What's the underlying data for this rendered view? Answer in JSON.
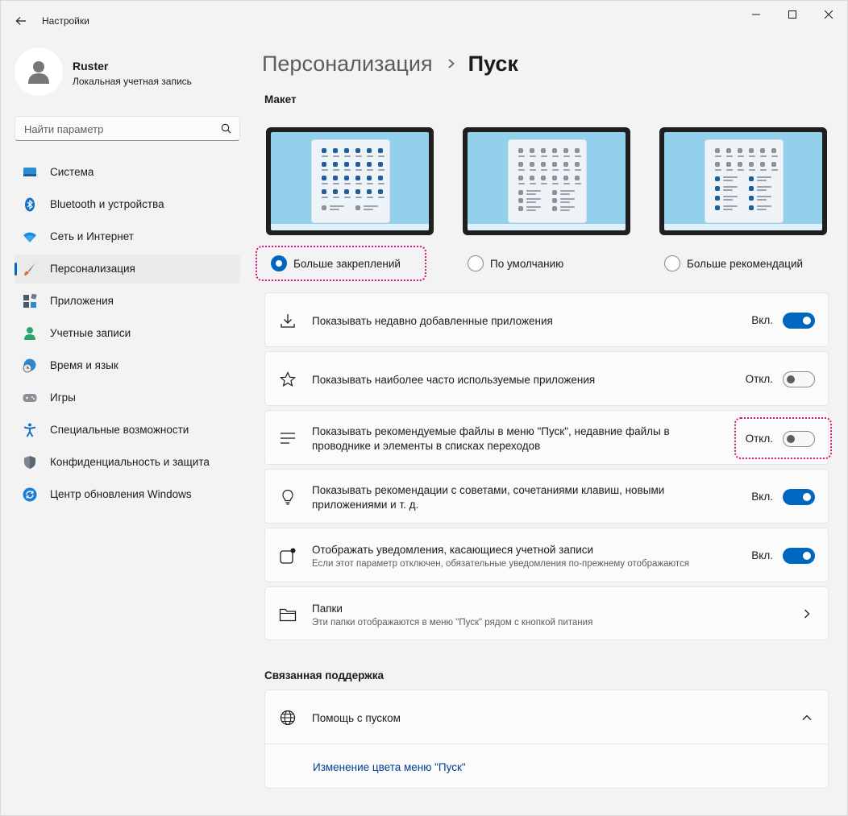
{
  "window": {
    "title": "Настройки"
  },
  "profile": {
    "name": "Ruster",
    "account_type": "Локальная учетная запись"
  },
  "search": {
    "placeholder": "Найти параметр"
  },
  "sidebar": {
    "items": [
      {
        "label": "Система",
        "icon": "system-icon"
      },
      {
        "label": "Bluetooth и устройства",
        "icon": "bluetooth-icon"
      },
      {
        "label": "Сеть и Интернет",
        "icon": "wifi-icon"
      },
      {
        "label": "Персонализация",
        "icon": "brush-icon",
        "active": true
      },
      {
        "label": "Приложения",
        "icon": "apps-icon"
      },
      {
        "label": "Учетные записи",
        "icon": "account-icon"
      },
      {
        "label": "Время и язык",
        "icon": "globe-clock-icon"
      },
      {
        "label": "Игры",
        "icon": "gamepad-icon"
      },
      {
        "label": "Специальные возможности",
        "icon": "accessibility-icon"
      },
      {
        "label": "Конфиденциальность и защита",
        "icon": "shield-icon"
      },
      {
        "label": "Центр обновления Windows",
        "icon": "update-icon"
      }
    ]
  },
  "breadcrumb": {
    "parent": "Персонализация",
    "current": "Пуск"
  },
  "layout_section": {
    "title": "Макет",
    "options": [
      {
        "label": "Больше закреплений",
        "selected": true
      },
      {
        "label": "По умолчанию",
        "selected": false
      },
      {
        "label": "Больше рекомендаций",
        "selected": false
      }
    ]
  },
  "settings": [
    {
      "icon": "download-icon",
      "title": "Показывать недавно добавленные приложения",
      "state": "Вкл.",
      "on": true
    },
    {
      "icon": "star-icon",
      "title": "Показывать наиболее часто используемые приложения",
      "state": "Откл.",
      "on": false
    },
    {
      "icon": "list-icon",
      "title_line1": "Показывать рекомендуемые файлы в меню \"Пуск\", недавние файлы в",
      "title_line2": "проводнике и элементы в списках переходов",
      "state": "Откл.",
      "on": false
    },
    {
      "icon": "lightbulb-icon",
      "title_line1": "Показывать рекомендации с советами, сочетаниями клавиш, новыми",
      "title_line2": "приложениями и т. д.",
      "state": "Вкл.",
      "on": true
    },
    {
      "icon": "notification-icon",
      "title": "Отображать уведомления, касающиеся учетной записи",
      "subtitle": "Если этот параметр отключен, обязательные уведомления по-прежнему отображаются",
      "state": "Вкл.",
      "on": true
    },
    {
      "icon": "folder-icon",
      "title": "Папки",
      "subtitle": "Эти папки отображаются в меню \"Пуск\" рядом с кнопкой питания"
    }
  ],
  "support": {
    "title": "Связанная поддержка",
    "help_title": "Помощь с пуском",
    "link": "Изменение цвета меню \"Пуск\""
  },
  "colors": {
    "accent": "#0067c0",
    "highlight": "#d6127d"
  }
}
